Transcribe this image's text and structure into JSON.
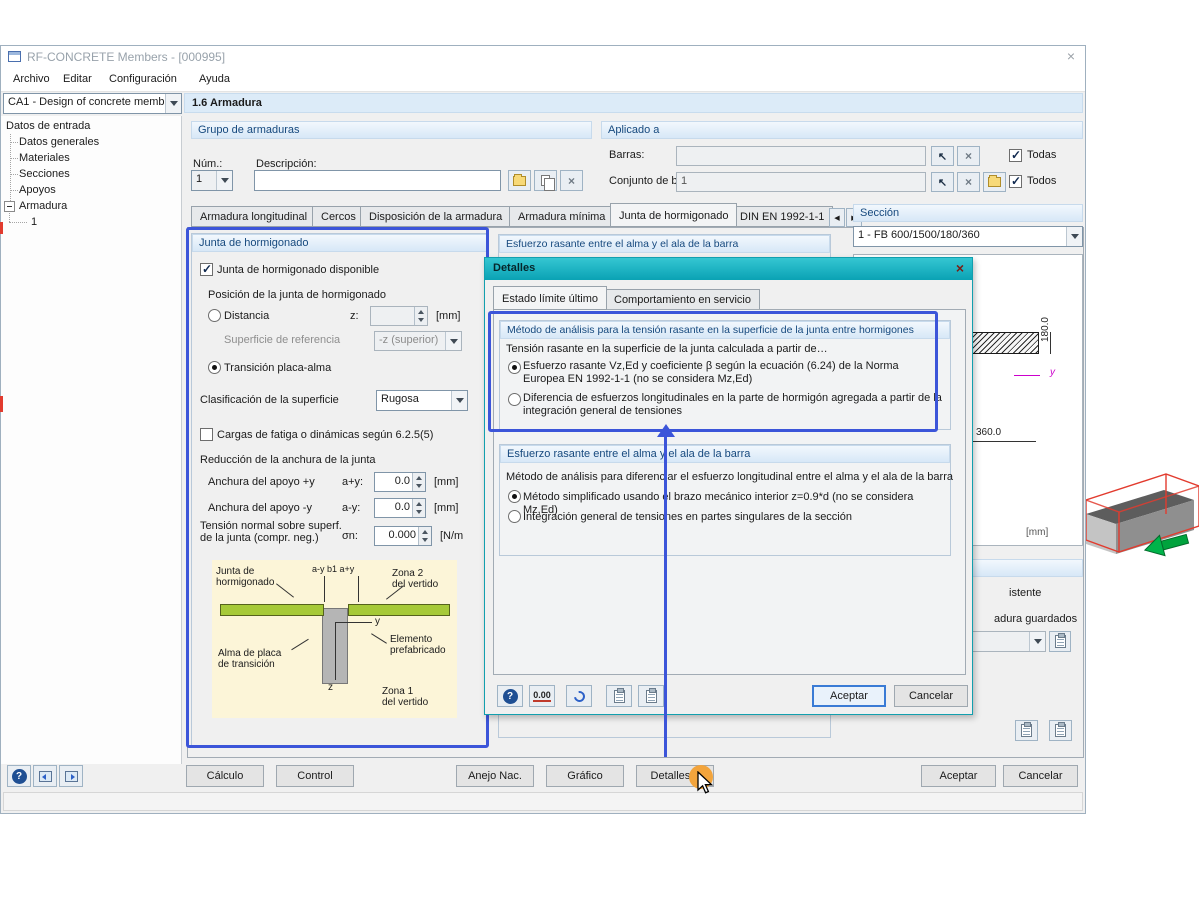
{
  "icons": {
    "close": "×",
    "delete": "×",
    "pick": "↖",
    "help": "?",
    "tabprev": "◀",
    "tabnext": "▶"
  },
  "window": {
    "title": "RF-CONCRETE Members - [000995]",
    "menus": [
      "Archivo",
      "Editar",
      "Configuración",
      "Ayuda"
    ],
    "case_selector": "CA1 - Design of concrete memb",
    "page_title": "1.6 Armadura"
  },
  "sidebar": {
    "root": "Datos de entrada",
    "items": [
      "Datos generales",
      "Materiales",
      "Secciones",
      "Apoyos",
      "Armadura"
    ],
    "armadura_child": "1"
  },
  "grupo": {
    "title": "Grupo de armaduras",
    "num_label": "Núm.:",
    "num_value": "1",
    "desc_label": "Descripción:",
    "desc_value": ""
  },
  "aplicado": {
    "title": "Aplicado a",
    "barras_label": "Barras:",
    "barras_value": "",
    "todas_label": "Todas",
    "conjunto_label": "Conjunto de barras:",
    "conjunto_value": "1",
    "todos_label": "Todos"
  },
  "tabs": [
    "Armadura longitudinal",
    "Cercos",
    "Disposición de la armadura",
    "Armadura mínima",
    "Junta de hormigonado",
    "DIN EN 1992-1-1"
  ],
  "seccion": {
    "title": "Sección",
    "value": "1 - FB 600/1500/180/360",
    "dim_height": "180.0",
    "dim_width": "360.0",
    "unit": "[mm]",
    "axis_y": "y"
  },
  "junta": {
    "title": "Junta de hormigonado",
    "available": "Junta de hormigonado disponible",
    "posicion": "Posición de la junta de hormigonado",
    "distancia": "Distancia",
    "z_sym": "z:",
    "z_value": "",
    "mm": "[mm]",
    "superficie": "Superficie de referencia",
    "superficie_value": "-z (superior)",
    "transicion": "Transición placa-alma",
    "clasificacion": "Clasificación de la superficie",
    "clasificacion_value": "Rugosa",
    "fatiga": "Cargas de fatiga o dinámicas según 6.2.5(5)",
    "reduccion": "Reducción de la anchura de la junta",
    "apoyo_pos": "Anchura del apoyo +y",
    "apoyo_pos_sym": "a+y:",
    "apoyo_pos_value": "0.0",
    "apoyo_neg": "Anchura del apoyo -y",
    "apoyo_neg_sym": "a-y:",
    "apoyo_neg_value": "0.0",
    "tension_l1": "Tensión normal sobre superf.",
    "tension_l2": "de la junta (compr. neg.)",
    "tension_sym": "σn:",
    "tension_value": "0.000",
    "tension_unit": "[N/m",
    "diagram": {
      "junta": "Junta de\nhormigonado",
      "dims": "a-y  b1  a+y",
      "zona2": "Zona 2\ndel vertido",
      "alma": "Alma de placa\nde transición",
      "elemento": "Elemento\nprefabricado",
      "axis_y": "y",
      "axis_z": "z",
      "zona1": "Zona 1\ndel vertido"
    }
  },
  "esfuerzo_bg_title": "Esfuerzo rasante entre el alma y el ala de la barra",
  "right_panel": {
    "frag_existente": "istente",
    "frag_guardados": "adura guardados"
  },
  "dialog": {
    "title": "Detalles",
    "tab1": "Estado límite último",
    "tab2": "Comportamiento en servicio",
    "g1_title": "Método de análisis para la tensión rasante en la superficie de la junta entre hormigones",
    "g1_intro": "Tensión rasante en la superficie de la junta calculada a partir de…",
    "g1_radio1": "Esfuerzo rasante Vz,Ed y coeficiente β según la ecuación (6.24) de la Norma Europea EN 1992-1-1 (no se considera Mz,Ed)",
    "g1_radio2": "Diferencia de esfuerzos longitudinales en la parte de hormigón agregada a partir de la integración general de tensiones",
    "g2_title": "Esfuerzo rasante entre el alma y el ala de la barra",
    "g2_intro": "Método de análisis para diferenciar el esfuerzo longitudinal entre el alma y el ala de la barra",
    "g2_radio1": "Método simplificado usando el brazo mecánico interior z=0.9*d (no se considera Mz,Ed)",
    "g2_radio2": "Integración general de tensiones en partes singulares de la sección",
    "zero_icon": "0.00",
    "ok": "Aceptar",
    "cancel": "Cancelar"
  },
  "footer": {
    "calculo": "Cálculo",
    "control": "Control",
    "anejo": "Anejo Nac.",
    "grafico": "Gráfico",
    "detalles": "Detalles...",
    "aceptar": "Aceptar",
    "cancelar": "Cancelar"
  }
}
